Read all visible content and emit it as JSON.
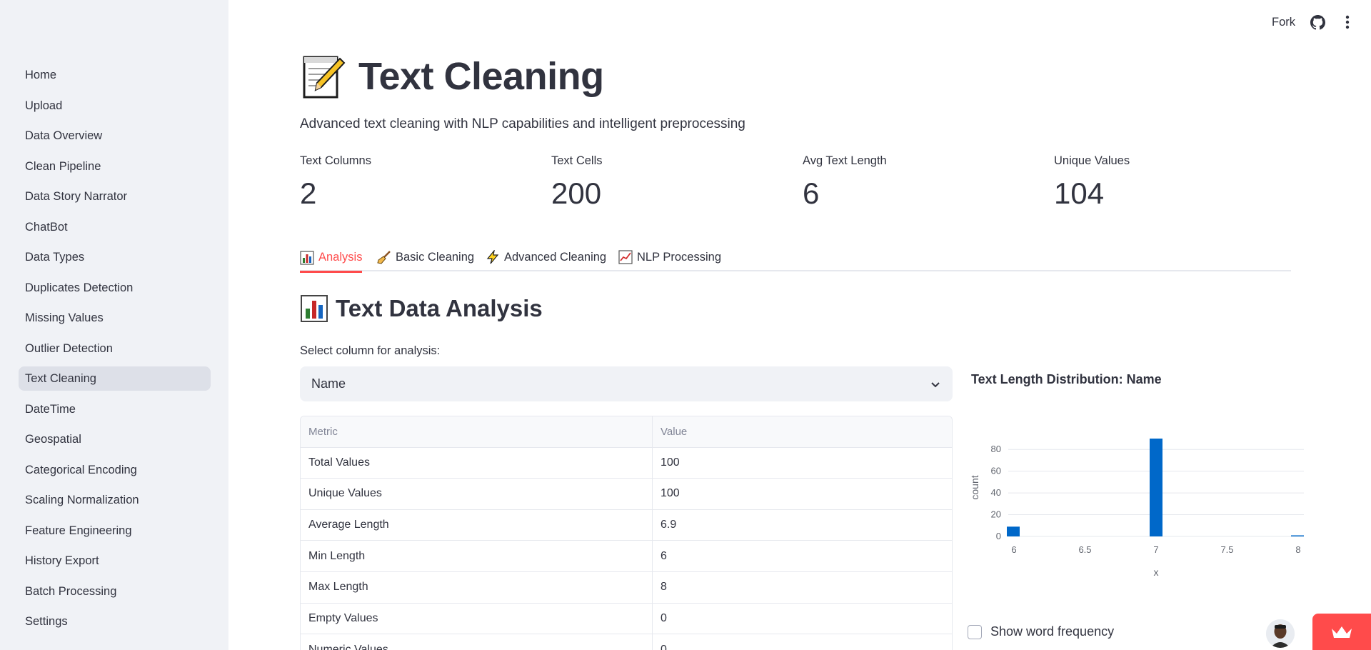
{
  "toolbar": {
    "fork_label": "Fork"
  },
  "sidebar": {
    "items": [
      {
        "label": "Home"
      },
      {
        "label": "Upload"
      },
      {
        "label": "Data Overview"
      },
      {
        "label": "Clean Pipeline"
      },
      {
        "label": "Data Story Narrator"
      },
      {
        "label": "ChatBot"
      },
      {
        "label": "Data Types"
      },
      {
        "label": "Duplicates Detection"
      },
      {
        "label": "Missing Values"
      },
      {
        "label": "Outlier Detection"
      },
      {
        "label": "Text Cleaning"
      },
      {
        "label": "DateTime"
      },
      {
        "label": "Geospatial"
      },
      {
        "label": "Categorical Encoding"
      },
      {
        "label": "Scaling Normalization"
      },
      {
        "label": "Feature Engineering"
      },
      {
        "label": "History Export"
      },
      {
        "label": "Batch Processing"
      },
      {
        "label": "Settings"
      }
    ],
    "active_index": 10
  },
  "page": {
    "title": "Text Cleaning",
    "subtitle": "Advanced text cleaning with NLP capabilities and intelligent preprocessing"
  },
  "metrics": [
    {
      "label": "Text Columns",
      "value": "2"
    },
    {
      "label": "Text Cells",
      "value": "200"
    },
    {
      "label": "Avg Text Length",
      "value": "6"
    },
    {
      "label": "Unique Values",
      "value": "104"
    }
  ],
  "tabs": [
    {
      "label": "Analysis",
      "icon": "bar-chart-icon",
      "active": true
    },
    {
      "label": "Basic Cleaning",
      "icon": "broom-icon"
    },
    {
      "label": "Advanced Cleaning",
      "icon": "lightning-icon"
    },
    {
      "label": "NLP Processing",
      "icon": "trend-chart-icon"
    }
  ],
  "analysis": {
    "section_title": "Text Data Analysis",
    "select_label": "Select column for analysis:",
    "selected_column": "Name",
    "table": {
      "headers": [
        "Metric",
        "Value"
      ],
      "rows": [
        [
          "Total Values",
          "100"
        ],
        [
          "Unique Values",
          "100"
        ],
        [
          "Average Length",
          "6.9"
        ],
        [
          "Min Length",
          "6"
        ],
        [
          "Max Length",
          "8"
        ],
        [
          "Empty Values",
          "0"
        ],
        [
          "Numeric Values",
          "0"
        ]
      ]
    },
    "chart_title": "Text Length Distribution: Name",
    "word_frequency_label": "Show word frequency"
  },
  "colors": {
    "accent": "#ff4b4b",
    "bar": "#0068c9",
    "sidebar_bg": "#f0f2f6"
  },
  "chart_data": {
    "type": "bar",
    "title": "Text Length Distribution: Name",
    "xlabel": "x",
    "ylabel": "count",
    "x": [
      6,
      7,
      8
    ],
    "values": [
      9,
      90,
      1
    ],
    "xlim": [
      6,
      8
    ],
    "ylim": [
      0,
      90
    ],
    "x_ticks": [
      "6",
      "6.5",
      "7",
      "7.5",
      "8"
    ],
    "y_ticks": [
      "0",
      "20",
      "40",
      "60",
      "80"
    ],
    "grid": true
  }
}
